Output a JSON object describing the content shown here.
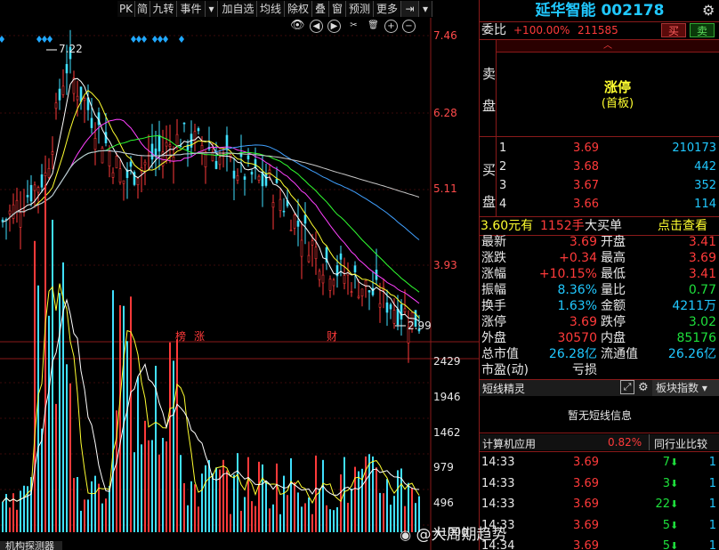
{
  "toolbar": {
    "buttons": [
      "PK",
      "简",
      "九转",
      "事件",
      "▾",
      "加自选",
      "均线",
      "除权",
      "叠",
      "窗",
      "预测",
      "更多",
      "⇥",
      "▾"
    ]
  },
  "chart": {
    "price_axis": [
      "7.46",
      "6.28",
      "5.11",
      "3.93"
    ],
    "volume_axis": [
      "2429",
      "1946",
      "1462",
      "979",
      "496",
      "X1000"
    ],
    "high_marker": "7.22",
    "low_marker": "2.99",
    "event_labels": [
      "榜",
      "涨",
      "财"
    ],
    "footer_label": "机构探测器",
    "control_icons": [
      "eye-icon",
      "prev-icon",
      "play-icon",
      "cut-icon",
      "delete-icon",
      "zoom-in-icon",
      "zoom-out-icon"
    ]
  },
  "header": {
    "title": "延华智能 002178",
    "settings_icon": "gear-icon"
  },
  "order_ratio": {
    "label": "委比",
    "ratio": "+100.00%",
    "diff": "211585",
    "buy_btn": "买",
    "sell_btn": "卖"
  },
  "sell_side": {
    "label_top": "卖",
    "label_bottom": "盘",
    "status": "涨停",
    "sub_status": "(首板)"
  },
  "buy_side": {
    "label_chars": [
      "买",
      "盘"
    ],
    "rows": [
      {
        "level": "1",
        "price": "3.69",
        "volume": "210173"
      },
      {
        "level": "2",
        "price": "3.68",
        "volume": "442"
      },
      {
        "level": "3",
        "price": "3.67",
        "volume": "352"
      },
      {
        "level": "4",
        "price": "3.66",
        "volume": "114"
      }
    ]
  },
  "big_order": {
    "price": "3.60元有",
    "qty": "1152手",
    "label": "大买单",
    "action": "点击查看"
  },
  "quote": {
    "rows": [
      {
        "l1": "最新",
        "v1": "3.69",
        "l2": "开盘",
        "v2": "3.41"
      },
      {
        "l1": "涨跌",
        "v1": "+0.34",
        "l2": "最高",
        "v2": "3.69"
      },
      {
        "l1": "涨幅",
        "v1": "+10.15%",
        "l2": "最低",
        "v2": "3.41"
      },
      {
        "l1": "振幅",
        "v1": "8.36%",
        "l2": "量比",
        "v2": "0.77"
      },
      {
        "l1": "换手",
        "v1": "1.63%",
        "l2": "金额",
        "v2": "4211万"
      },
      {
        "l1": "涨停",
        "v1": "3.69",
        "l2": "跌停",
        "v2": "3.02"
      },
      {
        "l1": "外盘",
        "v1": "30570",
        "l2": "内盘",
        "v2": "85176"
      },
      {
        "l1": "总市值",
        "v1": "26.28亿",
        "l2": "流通值",
        "v2": "26.26亿"
      },
      {
        "l1": "市盈(动)",
        "v1": "亏损",
        "l2": "",
        "v2": ""
      }
    ]
  },
  "short_line": {
    "title": "短线精灵",
    "tab": "板块指数",
    "empty": "暂无短线信息"
  },
  "sector": {
    "name": "计算机应用",
    "change": "0.82%",
    "compare": "同行业比较"
  },
  "ticks": [
    {
      "time": "14:33",
      "price": "3.69",
      "vol": "7",
      "n": "1"
    },
    {
      "time": "14:33",
      "price": "3.69",
      "vol": "3",
      "n": "1"
    },
    {
      "time": "14:33",
      "price": "3.69",
      "vol": "22",
      "n": "1"
    },
    {
      "time": "14:33",
      "price": "3.69",
      "vol": "5",
      "n": "1"
    },
    {
      "time": "14:34",
      "price": "3.69",
      "vol": "5",
      "n": "1"
    }
  ],
  "watermark": "@大周期趋势",
  "colors": {
    "up": "#ff3a3a",
    "down": "#1ee03c",
    "cyan": "#20c8ff",
    "yellow": "#ffff30",
    "border": "#8a1a1a"
  }
}
